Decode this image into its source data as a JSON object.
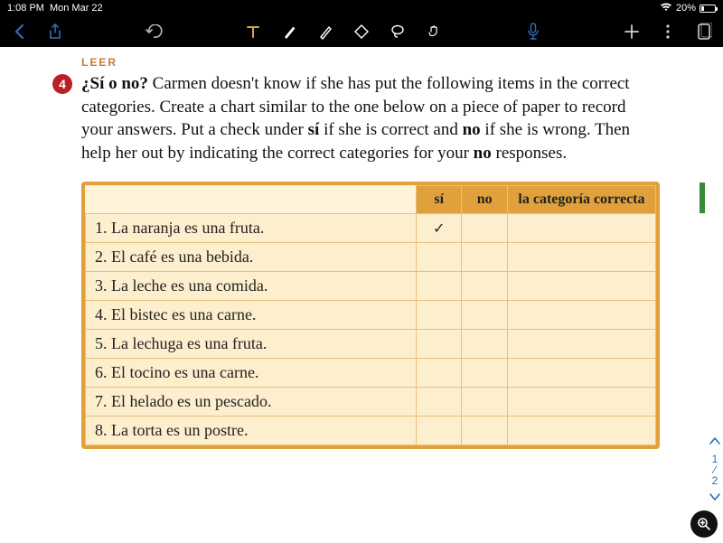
{
  "status": {
    "time": "1:08 PM",
    "date": "Mon Mar 22",
    "battery": "20%"
  },
  "content": {
    "leer": "LEER",
    "num": "4",
    "title": "¿Sí o no?",
    "body_rest": " Carmen doesn't know if she has put the following items in the correct categories. Create a chart similar to the one below on a piece of paper to record your answers. Put a check under ",
    "si_bold": "sí",
    "mid1": " if she is correct and ",
    "no_bold1": "no",
    "mid2": " if she is wrong. Then help her out by indicating the correct categories for your ",
    "no_bold2": "no",
    "tail": " responses."
  },
  "table": {
    "headers": {
      "si": "sí",
      "no": "no",
      "cat": "la categoría correcta"
    },
    "rows": [
      {
        "n": "1.",
        "text": "La naranja es una fruta.",
        "si": "✓",
        "no": "",
        "cat": ""
      },
      {
        "n": "2.",
        "text": "El café es una bebida.",
        "si": "",
        "no": "",
        "cat": ""
      },
      {
        "n": "3.",
        "text": "La leche es una comida.",
        "si": "",
        "no": "",
        "cat": ""
      },
      {
        "n": "4.",
        "text": "El bistec es una carne.",
        "si": "",
        "no": "",
        "cat": ""
      },
      {
        "n": "5.",
        "text": "La lechuga es una fruta.",
        "si": "",
        "no": "",
        "cat": ""
      },
      {
        "n": "6.",
        "text": "El tocino es una carne.",
        "si": "",
        "no": "",
        "cat": ""
      },
      {
        "n": "7.",
        "text": "El helado es un pescado.",
        "si": "",
        "no": "",
        "cat": ""
      },
      {
        "n": "8.",
        "text": "La torta es un postre.",
        "si": "",
        "no": "",
        "cat": ""
      }
    ]
  },
  "pager": {
    "cur": "1",
    "sep": "⁄",
    "tot": "2"
  }
}
